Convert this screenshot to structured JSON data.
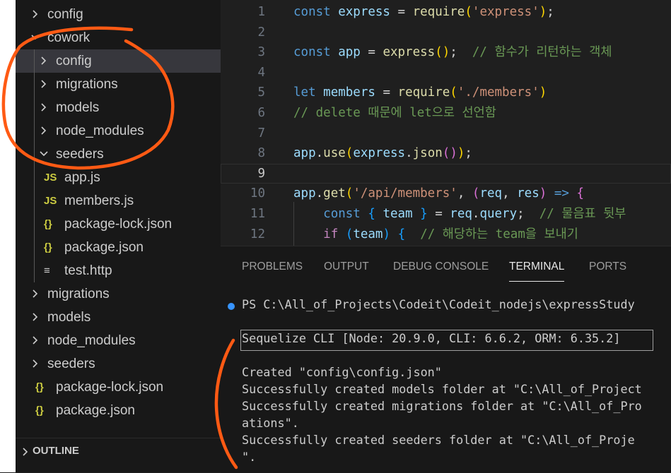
{
  "explorer": {
    "rows": [
      {
        "label": "config",
        "kind": "folder",
        "expanded": false
      },
      {
        "label": "cowork",
        "kind": "folder",
        "expanded": true
      },
      {
        "label": "config",
        "kind": "folder",
        "expanded": false,
        "selected": true
      },
      {
        "label": "migrations",
        "kind": "folder",
        "expanded": false
      },
      {
        "label": "models",
        "kind": "folder",
        "expanded": false
      },
      {
        "label": "node_modules",
        "kind": "folder",
        "expanded": false
      },
      {
        "label": "seeders",
        "kind": "folder",
        "expanded": true
      },
      {
        "label": "app.js",
        "kind": "js",
        "icon_text": "JS"
      },
      {
        "label": "members.js",
        "kind": "js",
        "icon_text": "JS"
      },
      {
        "label": "package-lock.json",
        "kind": "json",
        "icon_text": "{}"
      },
      {
        "label": "package.json",
        "kind": "json",
        "icon_text": "{}"
      },
      {
        "label": "test.http",
        "kind": "http",
        "icon_text": "≡"
      },
      {
        "label": "migrations",
        "kind": "folder",
        "expanded": false
      },
      {
        "label": "models",
        "kind": "folder",
        "expanded": false
      },
      {
        "label": "node_modules",
        "kind": "folder",
        "expanded": false
      },
      {
        "label": "seeders",
        "kind": "folder",
        "expanded": false
      },
      {
        "label": "package-lock.json",
        "kind": "json",
        "icon_text": "{}"
      },
      {
        "label": "package.json",
        "kind": "json",
        "icon_text": "{}"
      }
    ],
    "outline_label": "OUTLINE"
  },
  "editor": {
    "current_line": 9,
    "lines": [
      {
        "num": "1",
        "tokens": [
          [
            "kw",
            "const "
          ],
          [
            "var",
            "express"
          ],
          [
            "pl",
            " = "
          ],
          [
            "fn",
            "require"
          ],
          [
            "br1",
            "("
          ],
          [
            "str",
            "'express'"
          ],
          [
            "br1",
            ")"
          ],
          [
            "pl",
            ";"
          ]
        ]
      },
      {
        "num": "2",
        "tokens": []
      },
      {
        "num": "3",
        "tokens": [
          [
            "kw",
            "const "
          ],
          [
            "var",
            "app"
          ],
          [
            "pl",
            " = "
          ],
          [
            "fn",
            "express"
          ],
          [
            "br1",
            "()"
          ],
          [
            "pl",
            ";  "
          ],
          [
            "cm",
            "// 함수가 리턴하는 객체"
          ]
        ]
      },
      {
        "num": "4",
        "tokens": []
      },
      {
        "num": "5",
        "tokens": [
          [
            "kw",
            "let "
          ],
          [
            "var",
            "members"
          ],
          [
            "pl",
            " = "
          ],
          [
            "fn",
            "require"
          ],
          [
            "br1",
            "("
          ],
          [
            "str",
            "'./members'"
          ],
          [
            "br1",
            ")"
          ]
        ]
      },
      {
        "num": "6",
        "tokens": [
          [
            "cm",
            "// delete 때문에 let으로 선언함"
          ]
        ]
      },
      {
        "num": "7",
        "tokens": []
      },
      {
        "num": "8",
        "tokens": [
          [
            "var",
            "app"
          ],
          [
            "pl",
            "."
          ],
          [
            "fn",
            "use"
          ],
          [
            "br1",
            "("
          ],
          [
            "var",
            "express"
          ],
          [
            "pl",
            "."
          ],
          [
            "fn",
            "json"
          ],
          [
            "br2",
            "()"
          ],
          [
            "br1",
            ")"
          ],
          [
            "pl",
            ";"
          ]
        ]
      },
      {
        "num": "9",
        "tokens": []
      },
      {
        "num": "10",
        "tokens": [
          [
            "var",
            "app"
          ],
          [
            "pl",
            "."
          ],
          [
            "fn",
            "get"
          ],
          [
            "br1",
            "("
          ],
          [
            "str",
            "'/api/members'"
          ],
          [
            "pl",
            ", "
          ],
          [
            "br2",
            "("
          ],
          [
            "var",
            "req"
          ],
          [
            "pl",
            ", "
          ],
          [
            "var",
            "res"
          ],
          [
            "br2",
            ")"
          ],
          [
            "kw",
            " =>"
          ],
          [
            "pl",
            " "
          ],
          [
            "br2",
            "{"
          ]
        ]
      },
      {
        "num": "11",
        "tokens": [
          [
            "pl",
            "    "
          ],
          [
            "kw",
            "const "
          ],
          [
            "br3",
            "{ "
          ],
          [
            "var",
            "team"
          ],
          [
            "br3",
            " }"
          ],
          [
            "pl",
            " = "
          ],
          [
            "var",
            "req"
          ],
          [
            "pl",
            "."
          ],
          [
            "var",
            "query"
          ],
          [
            "pl",
            ";  "
          ],
          [
            "cm",
            "// 물음표 뒷부"
          ]
        ]
      },
      {
        "num": "12",
        "tokens": [
          [
            "pl",
            "    "
          ],
          [
            "kw2",
            "if "
          ],
          [
            "br3",
            "("
          ],
          [
            "var",
            "team"
          ],
          [
            "br3",
            ")"
          ],
          [
            "pl",
            " "
          ],
          [
            "br3",
            "{"
          ],
          [
            "pl",
            "  "
          ],
          [
            "cm",
            "// 해당하는 team을 보내기"
          ]
        ]
      }
    ]
  },
  "panel": {
    "tabs": [
      "PROBLEMS",
      "OUTPUT",
      "DEBUG CONSOLE",
      "TERMINAL",
      "PORTS"
    ],
    "active_tab": "TERMINAL",
    "terminal": [
      "PS C:\\All_of_Projects\\Codeit\\Codeit_nodejs\\expressStudy",
      "",
      "Sequelize CLI [Node: 20.9.0, CLI: 6.6.2, ORM: 6.35.2]",
      "",
      "Created \"config\\config.json\"",
      "Successfully created models folder at \"C:\\All_of_Project",
      "Successfully created migrations folder at \"C:\\All_of_Pro",
      "ations\".",
      "Successfully created seeders folder at \"C:\\All_of_Proje",
      "\"."
    ]
  },
  "colors": {
    "annotation": "#ff5a14",
    "js_icon": "#cbcb41",
    "json_icon": "#cbcb41",
    "accent": "#3794ff"
  }
}
